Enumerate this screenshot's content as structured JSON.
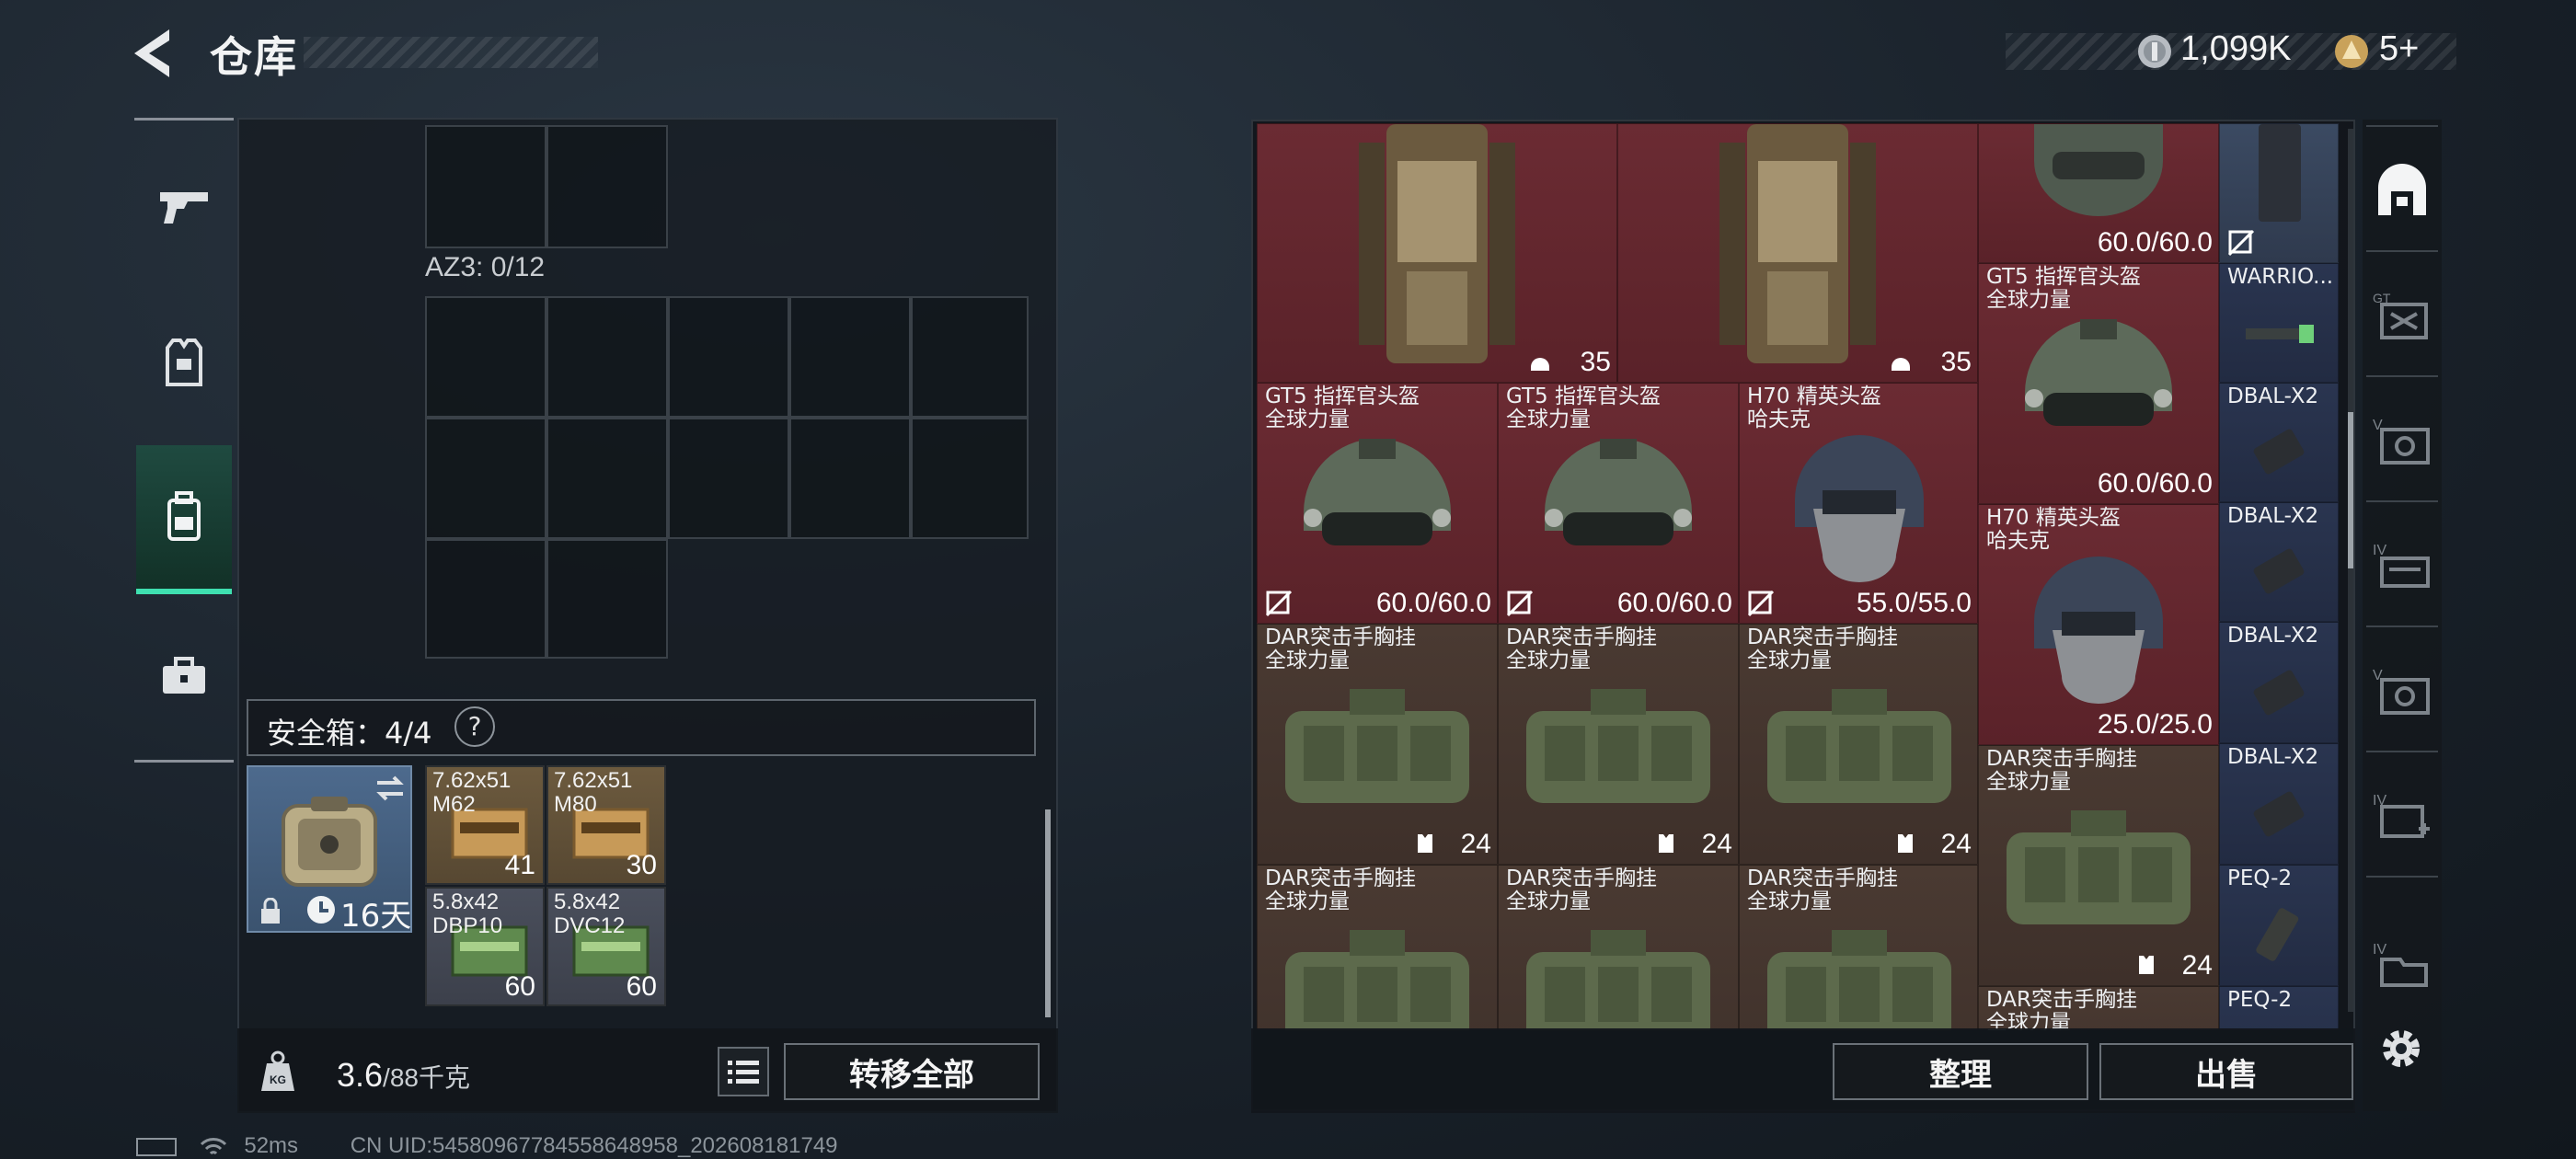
{
  "header": {
    "title": "仓库",
    "currency_primary": "1,099K",
    "currency_secondary": "5+"
  },
  "left_rail": {
    "items": [
      {
        "icon": "pistol-icon"
      },
      {
        "icon": "vest-icon"
      },
      {
        "icon": "backpack-icon",
        "active": true
      },
      {
        "icon": "briefcase-icon"
      }
    ]
  },
  "container": {
    "az3_label": "AZ3: 0/12",
    "safebox_label": "安全箱：4/4",
    "safebox_help": "?",
    "safebox_days": "16天",
    "ammo": [
      {
        "name": "7.62x51\nM62",
        "count": "41"
      },
      {
        "name": "7.62x51\nM80",
        "count": "30"
      },
      {
        "name": "5.8x42\nDBP10",
        "count": "60"
      },
      {
        "name": "5.8x42\nDVC12",
        "count": "60"
      }
    ]
  },
  "left_footer": {
    "weight_current": "3.6",
    "weight_max": "/88千克",
    "transfer_all": "转移全部"
  },
  "warehouse": {
    "cells": [
      {
        "name": "",
        "value": "35",
        "badge": "armor"
      },
      {
        "name": "",
        "value": "35",
        "badge": "armor"
      },
      {
        "name": "",
        "value": "60.0/60.0",
        "badge": "no-trade"
      },
      {
        "name": "",
        "value": "",
        "badge": "no-trade"
      },
      {
        "name": "GT5 指挥官头盔\n全球力量",
        "value": "60.0/60.0",
        "badge": ""
      },
      {
        "name": "WARRIO...",
        "value": "",
        "badge": ""
      },
      {
        "name": "GT5 指挥官头盔\n全球力量",
        "value": "60.0/60.0",
        "badge": "no-trade"
      },
      {
        "name": "GT5 指挥官头盔\n全球力量",
        "value": "60.0/60.0",
        "badge": "no-trade"
      },
      {
        "name": "H70 精英头盔\n哈夫克",
        "value": "55.0/55.0",
        "badge": "no-trade"
      },
      {
        "name": "DBAL-X2",
        "value": "",
        "badge": ""
      },
      {
        "name": "H70 精英头盔\n哈夫克",
        "value": "25.0/25.0",
        "badge": ""
      },
      {
        "name": "DBAL-X2",
        "value": "",
        "badge": ""
      },
      {
        "name": "DAR突击手胸挂\n全球力量",
        "value": "24",
        "badge": "vest"
      },
      {
        "name": "DAR突击手胸挂\n全球力量",
        "value": "24",
        "badge": "vest"
      },
      {
        "name": "DAR突击手胸挂\n全球力量",
        "value": "24",
        "badge": "vest"
      },
      {
        "name": "DBAL-X2",
        "value": "",
        "badge": ""
      },
      {
        "name": "DAR突击手胸挂\n全球力量",
        "value": "24",
        "badge": "vest"
      },
      {
        "name": "DBAL-X2",
        "value": "",
        "badge": ""
      },
      {
        "name": "DAR突击手胸挂\n全球力量",
        "value": "",
        "badge": ""
      },
      {
        "name": "DAR突击手胸挂\n全球力量",
        "value": "",
        "badge": ""
      },
      {
        "name": "DAR突击手胸挂\n全球力量",
        "value": "",
        "badge": ""
      },
      {
        "name": "PEQ-2",
        "value": "",
        "badge": ""
      },
      {
        "name": "DAR突击手胸挂\n全球力量",
        "value": "",
        "badge": ""
      },
      {
        "name": "PEQ-2",
        "value": "",
        "badge": ""
      }
    ]
  },
  "right_footer": {
    "sort_label": "整理",
    "sell_label": "出售"
  },
  "right_rail": {
    "labels": [
      "",
      "GT",
      "V",
      "IV",
      "V",
      "IV",
      "IV"
    ]
  },
  "status": {
    "ping": "52ms",
    "uid": "CN UID:54580967784558648958_202608181749"
  },
  "colors": {
    "accent": "#3fe0b0",
    "red_rarity": "#6b2b33",
    "brown_rarity": "#4a3a32",
    "blue_rarity": "#3b4a62"
  }
}
